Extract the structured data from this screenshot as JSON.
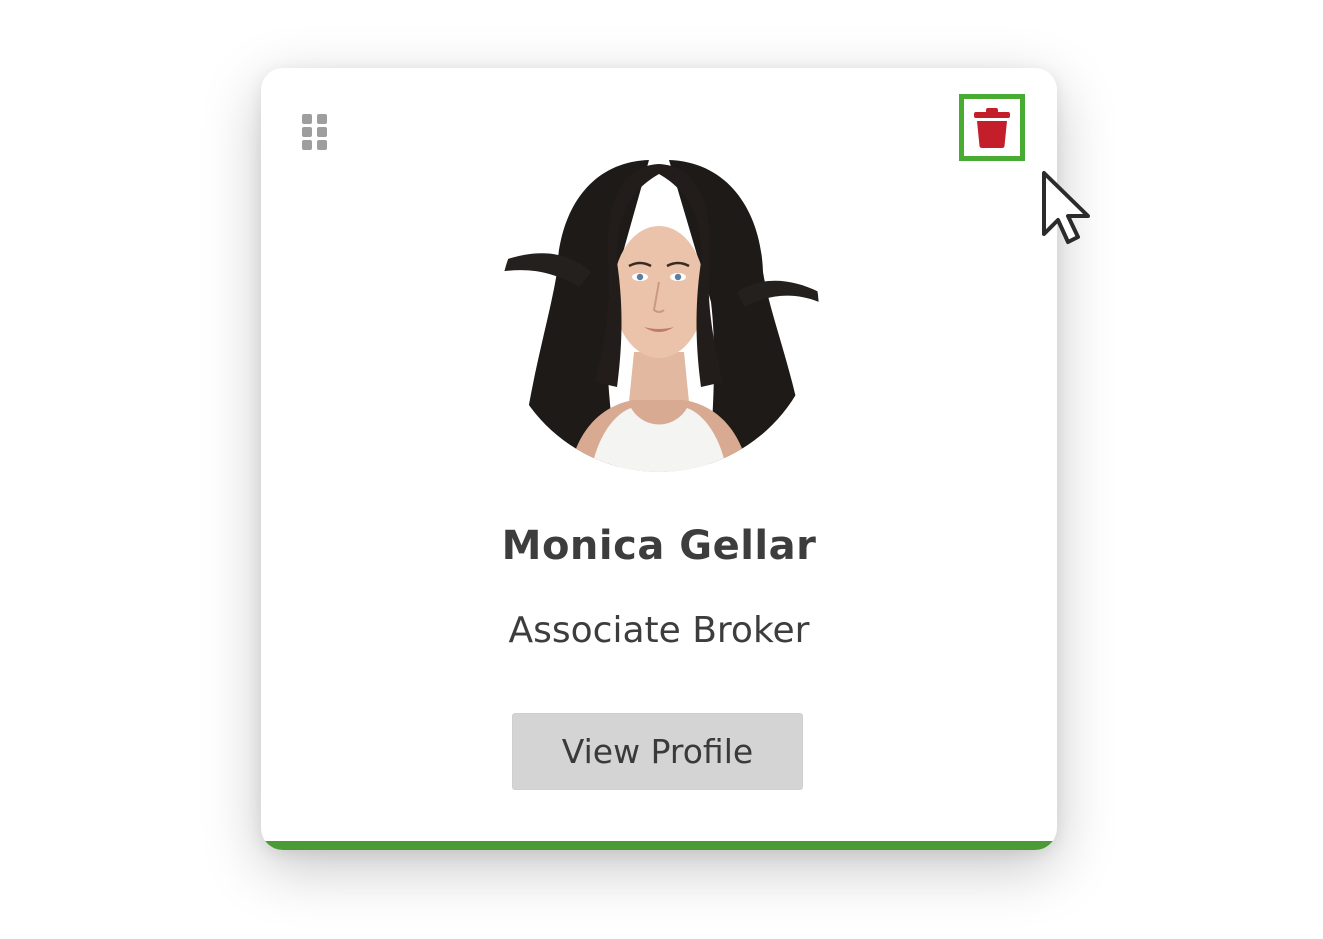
{
  "profile_card": {
    "name": "Monica Gellar",
    "title": "Associate Broker",
    "view_profile_label": "View Profile",
    "accent_color": "#4a9a35",
    "highlight_color": "#4aab32",
    "delete_icon_color": "#c41e2b",
    "drag_handle_icon": "grip-icon",
    "delete_icon": "trash-icon",
    "avatar_image": "profile-photo"
  },
  "pointer": {
    "icon": "mouse-cursor-icon"
  }
}
